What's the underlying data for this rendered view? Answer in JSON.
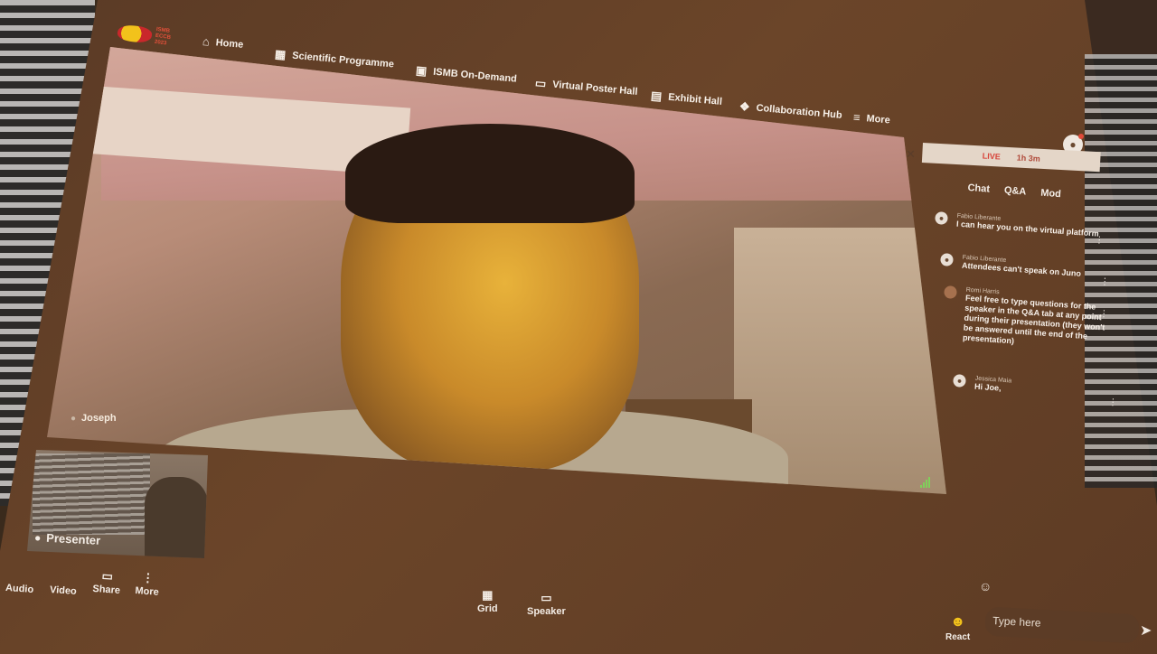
{
  "logo": {
    "text_lines": [
      "ISMB",
      "ECCB",
      "2023"
    ]
  },
  "nav": [
    {
      "label": "Home",
      "icon": "home-icon",
      "glyph": "⌂"
    },
    {
      "label": "Scientific Programme",
      "icon": "calendar-icon",
      "glyph": "▦"
    },
    {
      "label": "ISMB On-Demand",
      "icon": "book-icon",
      "glyph": "▣"
    },
    {
      "label": "Virtual Poster Hall",
      "icon": "poster-icon",
      "glyph": "▭"
    },
    {
      "label": "Exhibit Hall",
      "icon": "booth-icon",
      "glyph": "▤"
    },
    {
      "label": "Collaboration Hub",
      "icon": "people-icon",
      "glyph": "❖"
    },
    {
      "label": "More",
      "icon": "menu-icon",
      "glyph": "≡"
    }
  ],
  "video": {
    "participant_name": "Joseph"
  },
  "side": {
    "live_label": "LIVE",
    "elapsed": "1h 3m",
    "tabs": [
      "Chat",
      "Q&A",
      "Mod"
    ],
    "messages": [
      {
        "author": "Fabio Liberante",
        "text": "I can hear you on the virtual platform"
      },
      {
        "author": "Fabio Liberante",
        "text": "Attendees can't speak on Juno"
      },
      {
        "author": "Romi Harris",
        "text": "Feel free to type questions for the speaker in the Q&A tab at any point during their presentation (they won't be answered until the end of the presentation)"
      },
      {
        "author": "Jessica Maia",
        "text": "Hi Joe,"
      }
    ]
  },
  "presenter": {
    "label": "Presenter"
  },
  "controls": {
    "left": [
      {
        "label": "Audio",
        "icon": "microphone-icon"
      },
      {
        "label": "Video",
        "icon": "camera-icon"
      },
      {
        "label": "Share",
        "icon": "screen-share-icon",
        "glyph": "▭"
      },
      {
        "label": "More",
        "icon": "more-vertical-icon",
        "glyph": "⋮"
      }
    ],
    "center": [
      {
        "label": "Grid",
        "icon": "grid-icon",
        "glyph": "▦"
      },
      {
        "label": "Speaker",
        "icon": "speaker-view-icon",
        "glyph": "▭"
      }
    ]
  },
  "chat_input": {
    "placeholder": "Type here"
  },
  "react": {
    "label": "React"
  }
}
